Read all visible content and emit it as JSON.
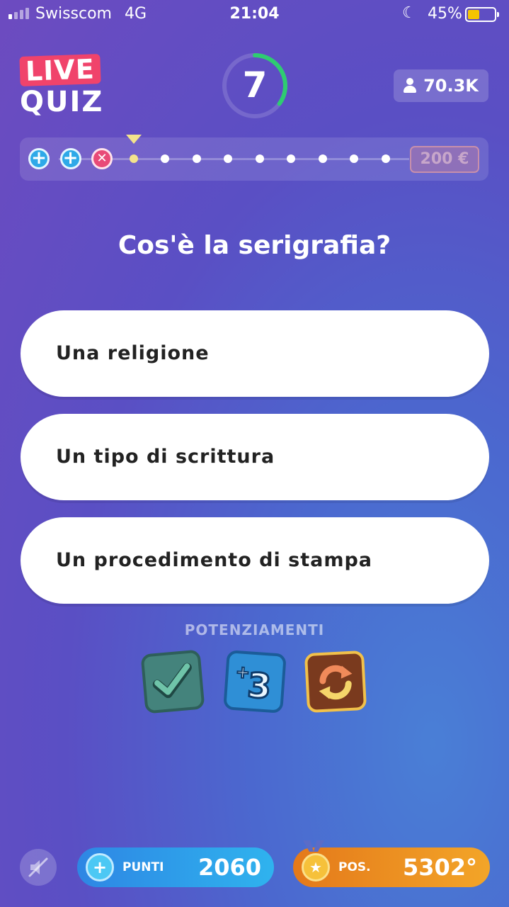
{
  "status_bar": {
    "carrier": "Swisscom",
    "network": "4G",
    "time": "21:04",
    "battery_percent": "45%",
    "battery_level": 0.45
  },
  "logo": {
    "line1": "LIVE",
    "line2": "QUIZ"
  },
  "timer": {
    "value": "7",
    "remaining_fraction": 0.35,
    "arc_color": "#2ecc71"
  },
  "viewers": {
    "count": "70.3K",
    "icon": "person-icon"
  },
  "progress": {
    "prize": "200 €",
    "nodes": [
      {
        "state": "correct-bonus",
        "icon": "plus-icon"
      },
      {
        "state": "correct-bonus",
        "icon": "plus-icon"
      },
      {
        "state": "wrong",
        "icon": "x-icon"
      },
      {
        "state": "current"
      },
      {
        "state": "upcoming"
      },
      {
        "state": "upcoming"
      },
      {
        "state": "upcoming"
      },
      {
        "state": "upcoming"
      },
      {
        "state": "upcoming"
      },
      {
        "state": "upcoming"
      },
      {
        "state": "upcoming"
      },
      {
        "state": "upcoming"
      }
    ]
  },
  "question": "Cos'è la serigrafia?",
  "answers": [
    "Una religione",
    "Un tipo di scrittura",
    "Un procedimento di stampa"
  ],
  "powerups": {
    "title": "POTENZIAMENTI",
    "items": [
      {
        "name": "check-icon",
        "color": "#44837c"
      },
      {
        "name": "plus-three-icon",
        "color": "#2f8fd6"
      },
      {
        "name": "refresh-icon",
        "color": "#7a3a1e"
      }
    ]
  },
  "bottom_bar": {
    "mute_icon": "speaker-muted-icon",
    "points_label": "PUNTI",
    "points_value": "2060",
    "position_label": "POS.",
    "position_value": "5302°"
  }
}
